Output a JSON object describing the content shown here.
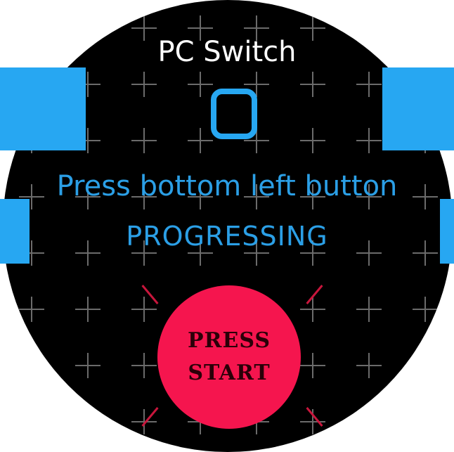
{
  "app": {
    "title": "PC Switch"
  },
  "indicator": {
    "digit": "0"
  },
  "instruction": {
    "text": "Press bottom left button"
  },
  "status": {
    "text": "PROGRESSING"
  },
  "start_button": {
    "line1": "PRESS",
    "line2": "START"
  },
  "colors": {
    "accent": "#27a7f2",
    "text_blue": "#2b9fe6",
    "start_red": "#f5154e",
    "background": "#000000",
    "grid": "#6b6b6b"
  },
  "icons": {
    "corner_tabs": "blue-tab-icon",
    "burst_rays": "burst-ray-icon"
  }
}
